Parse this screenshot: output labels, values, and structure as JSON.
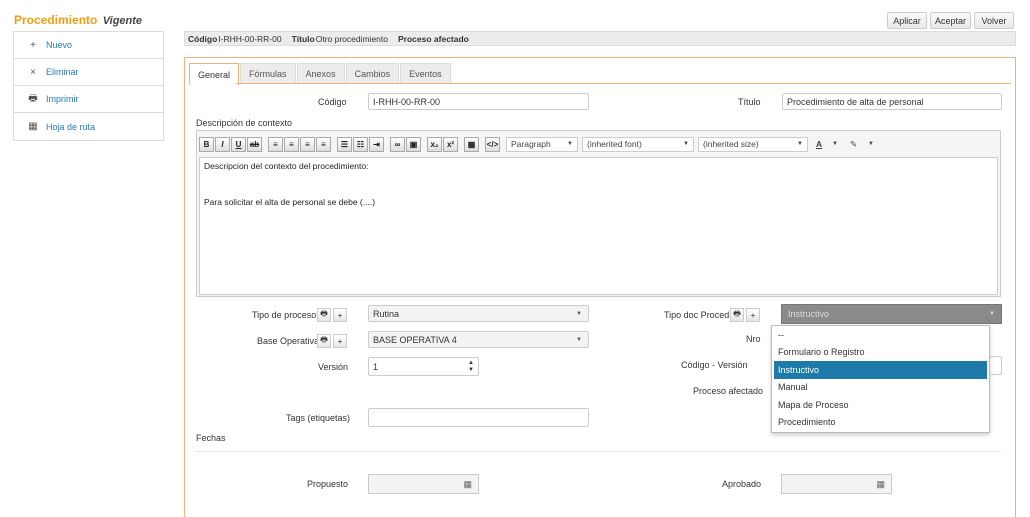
{
  "title": {
    "main": "Procedimiento",
    "sub": "Vigente"
  },
  "sidebar": {
    "items": [
      {
        "icon": "+",
        "label": "Nuevo"
      },
      {
        "icon": "×",
        "label": "Eliminar"
      },
      {
        "icon": "🖶",
        "label": "Imprimir"
      },
      {
        "icon": "▦",
        "label": "Hoja de ruta"
      }
    ]
  },
  "actions": {
    "apply": "Aplicar",
    "accept": "Aceptar",
    "back": "Volver"
  },
  "infobar": {
    "code_label": "Código",
    "code_value": "I-RHH-00-RR-00",
    "title_label": "Título",
    "title_value": "Otro procedimiento",
    "affected_label": "Proceso afectado"
  },
  "tabs": [
    "General",
    "Fórmulas",
    "Anexos",
    "Cambios",
    "Eventos"
  ],
  "form": {
    "codigo_label": "Código",
    "codigo_value": "I-RHH-00-RR-00",
    "titulo_label": "Título",
    "titulo_value": "Procedimiento de alta de personal",
    "descripcion_label": "Descripción de contexto",
    "editor": {
      "format_select": "Paragraph",
      "font_select": "(inherited font)",
      "size_select": "(inherited size)",
      "line1": "Descripcion del contexto del procedimiento:",
      "line2": "Para solicitar el alta de personal se debe (....)"
    },
    "tipo_proceso_label": "Tipo de proceso",
    "tipo_proceso_value": "Rutina",
    "base_operativa_label": "Base Operativa",
    "base_operativa_value": "BASE OPERATIVA 4",
    "version_label": "Versión",
    "version_value": "1",
    "tags_label": "Tags (etiquetas)",
    "tags_value": "",
    "fechas_label": "Fechas",
    "tipo_doc_label": "Tipo doc Proced",
    "tipo_doc_value": "Instructivo",
    "nro_label": "Nro",
    "codigo_version_label": "Código - Versión",
    "proceso_afectado_label": "Proceso afectado",
    "propuesto_label": "Propuesto",
    "aprobado_label": "Aprobado"
  },
  "dropdown": {
    "options": [
      "--",
      "Formulario o Registro",
      "Instructivo",
      "Manual",
      "Mapa de Proceso",
      "Procedimiento"
    ],
    "selected": "Instructivo"
  },
  "colors": {
    "accent": "#f39c12",
    "link": "#2a7ab8",
    "highlight": "#1e7aa8",
    "tab_border": "#f0b27a"
  }
}
